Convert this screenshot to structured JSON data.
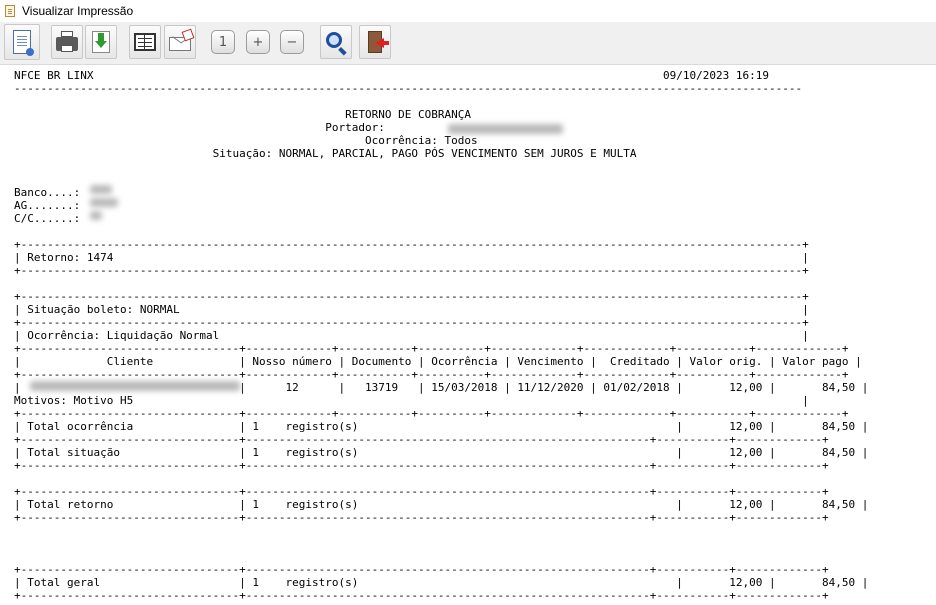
{
  "window": {
    "title": "Visualizar Impressão"
  },
  "toolbar": {
    "buttons": [
      {
        "name": "page-setup-button",
        "icon": "page-icon"
      },
      {
        "name": "print-button",
        "icon": "printer-icon"
      },
      {
        "name": "save-button",
        "icon": "download-icon"
      },
      {
        "name": "export-button",
        "icon": "table-icon"
      },
      {
        "name": "email-button",
        "icon": "envelope-icon"
      },
      {
        "name": "zoom-one-button",
        "icon": "one-icon",
        "glyph": "1"
      },
      {
        "name": "zoom-in-button",
        "icon": "plus-icon",
        "glyph": "+"
      },
      {
        "name": "zoom-out-button",
        "icon": "minus-icon",
        "glyph": "−"
      },
      {
        "name": "search-button",
        "icon": "magnifier-icon"
      },
      {
        "name": "exit-button",
        "icon": "exit-door-icon"
      }
    ]
  },
  "report": {
    "lines": [
      "NFCE BR LINX                                                                                      09/10/2023 16:19",
      "-----------------------------------------------------------------------------------------------------------------------",
      "",
      "                                                  RETORNO DE COBRANÇA",
      "                                               Portador:",
      "                                                     Ocorrência: Todos",
      "                              Situação: NORMAL, PARCIAL, PAGO PÓS VENCIMENTO SEM JUROS E MULTA",
      "",
      "",
      "Banco....:",
      "AG.......:",
      "C/C......:",
      "",
      "+----------------------------------------------------------------------------------------------------------------------+",
      "| Retorno: 1474                                                                                                        |",
      "+----------------------------------------------------------------------------------------------------------------------+",
      "",
      "+----------------------------------------------------------------------------------------------------------------------+",
      "| Situação boleto: NORMAL                                                                                              |",
      "+----------------------------------------------------------------------------------------------------------------------+",
      "| Ocorrência: Liquidação Normal                                                                                        |",
      "+---------------------------------+-------------+-----------+----------+-------------+-------------+-----------+-------------+",
      "|             Cliente             | Nosso número | Documento | Ocorrência | Vencimento |  Creditado | Valor orig. | Valor pago |",
      "+---------------------------------+-------------+-----------+----------+-------------+-------------+-----------+-------------+",
      "|                                 |      12      |   13719   | 15/03/2018 | 11/12/2020 | 01/02/2018 |       12,00 |       84,50 |",
      "Motivos: Motivo H5                                                                                                     |",
      "+---------------------------------+-------------+-----------+----------+-------------+-------------+-----------+-------------+",
      "| Total ocorrência                | 1    registro(s)                                                |       12,00 |       84,50 |",
      "+---------------------------------+-------------------------------------------------------------+-----------+-------------+",
      "| Total situação                  | 1    registro(s)                                                |       12,00 |       84,50 |",
      "+---------------------------------+-------------------------------------------------------------+-----------+-------------+",
      "",
      "+---------------------------------+-------------------------------------------------------------+-----------+-------------+",
      "| Total retorno                   | 1    registro(s)                                                |       12,00 |       84,50 |",
      "+---------------------------------+-------------------------------------------------------------+-----------+-------------+",
      "",
      "",
      "",
      "+---------------------------------+-------------------------------------------------------------+-----------+-------------+",
      "| Total geral                     | 1    registro(s)                                                |       12,00 |       84,50 |",
      "+---------------------------------+-------------------------------------------------------------+-----------+-------------+"
    ]
  }
}
